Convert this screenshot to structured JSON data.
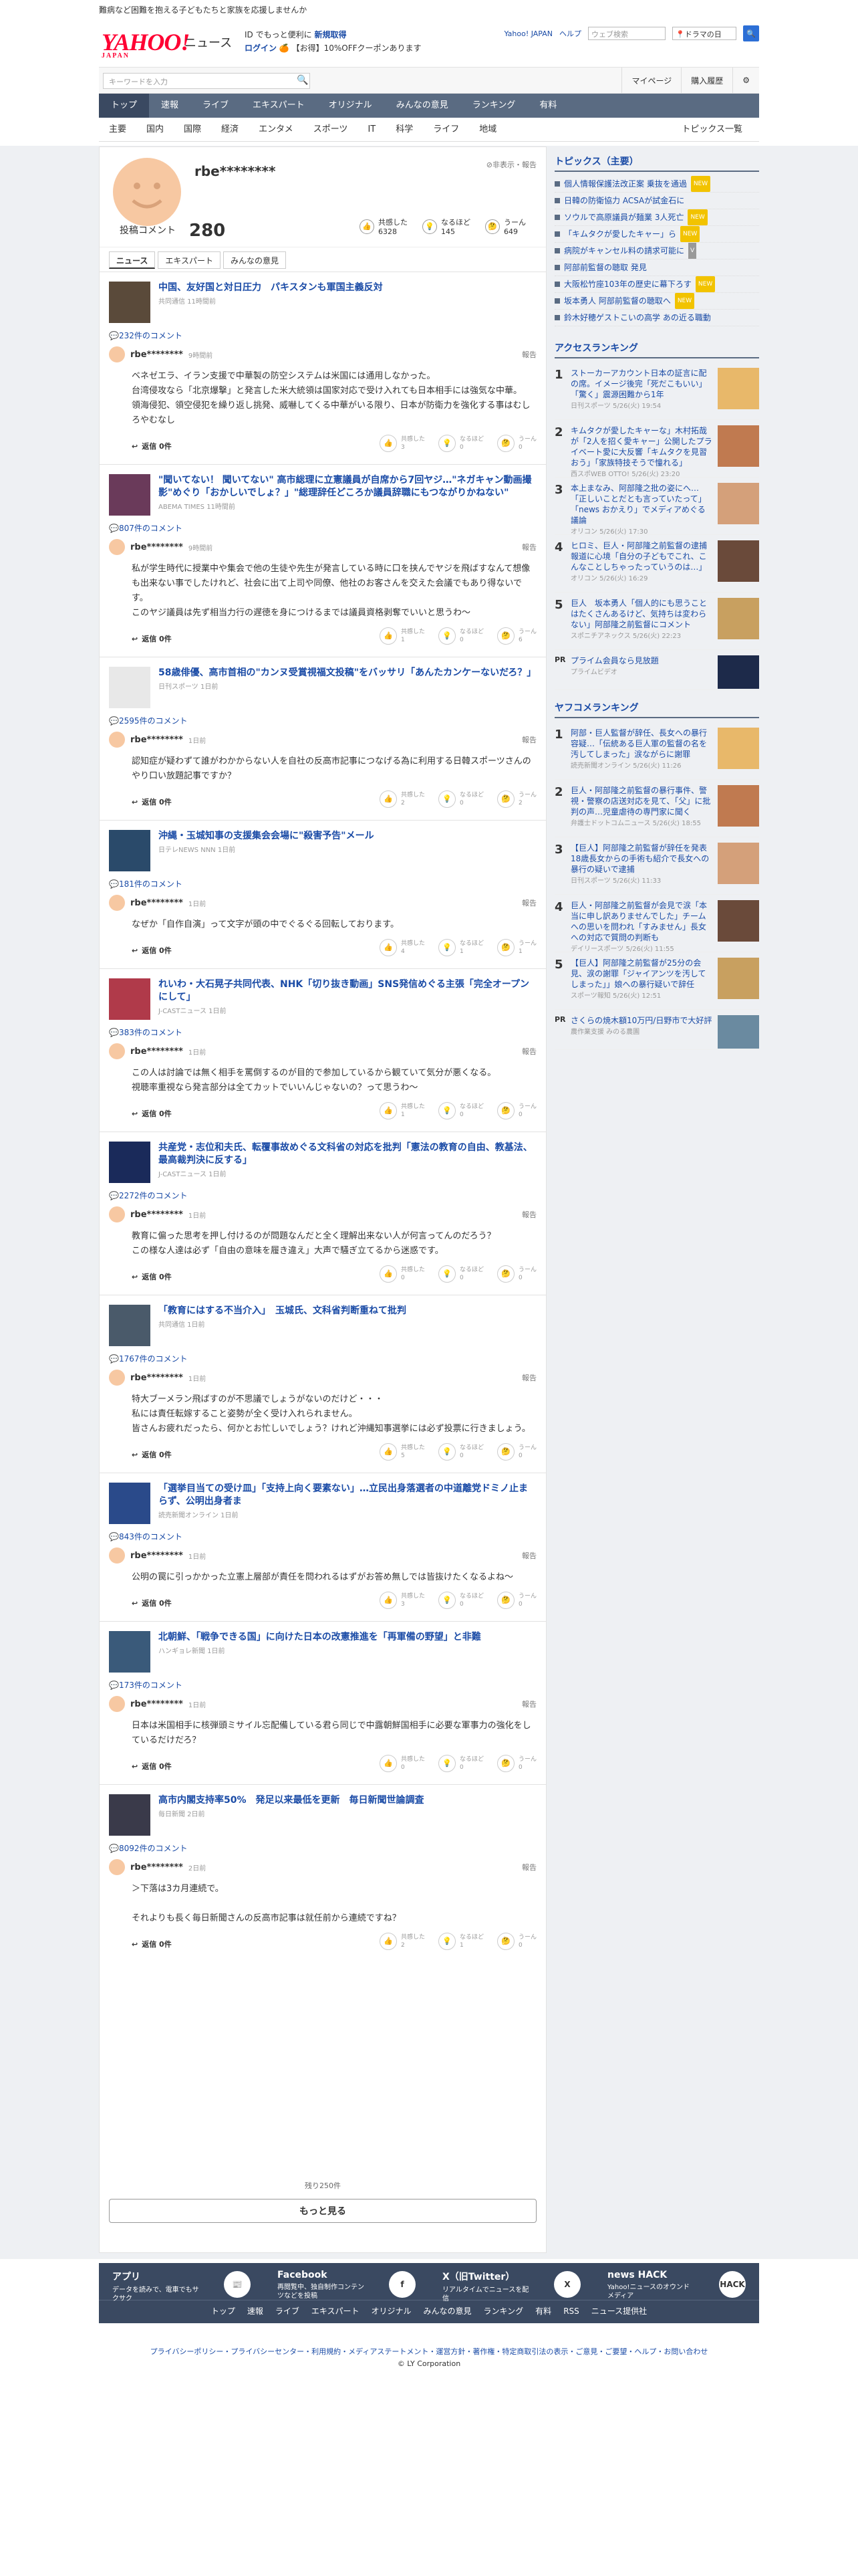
{
  "promo": "難病など困難を抱える子どもたちと家族を応援しませんか",
  "header": {
    "logo": "YAHOO!",
    "logo_sub": "JAPAN",
    "service": "ニュース",
    "reg1": "ID でもっと便利に",
    "reg1_link": "新規取得",
    "reg2_login": "ログイン",
    "reg2": "【お得】10%OFFクーポンあります",
    "yahoo_japan": "Yahoo! JAPAN",
    "help": "ヘルプ",
    "web_search_ph": "ウェブ検索",
    "keyword": "ドラマの日",
    "search_ph": "キーワードを入力",
    "mypage": "マイページ",
    "purchase": "購入履歴"
  },
  "nav": [
    "トップ",
    "速報",
    "ライブ",
    "エキスパート",
    "オリジナル",
    "みんなの意見",
    "ランキング",
    "有料"
  ],
  "subnav": [
    "主要",
    "国内",
    "国際",
    "経済",
    "エンタメ",
    "スポーツ",
    "IT",
    "科学",
    "ライフ",
    "地域"
  ],
  "subnav_right": "トピックス一覧",
  "profile": {
    "name": "rbe********",
    "hide": "非表示・報告",
    "count_label": "投稿コメント",
    "count": "280",
    "stats": [
      {
        "l": "共感した",
        "v": "6328"
      },
      {
        "l": "なるほど",
        "v": "145"
      },
      {
        "l": "うーん",
        "v": "649"
      }
    ]
  },
  "tabs": [
    "ニュース",
    "エキスパート",
    "みんなの意見"
  ],
  "entries": [
    {
      "title": "中国、友好国と対日圧力　パキスタンも軍国主義反対",
      "src": "共同通信 11時間前",
      "cnt": "232件のコメント",
      "user": "rbe********",
      "time": "9時間前",
      "text": "ベネゼエラ、イラン支援で中華製の防空システムは米国には通用しなかった。\n台湾侵攻なら「北京爆撃」と発言した米大統領は国家対応で受け入れても日本相手には強気な中華。\n領海侵犯、領空侵犯を繰り返し挑発、威嚇してくる中華がいる限り、日本が防衛力を強化する事はむしろやむなし",
      "rep": "報告",
      "reply": "返信 0件",
      "r": [
        "3",
        "0",
        "0"
      ],
      "th": "#5a4a3a"
    },
    {
      "title": "\"聞いてない！ 聞いてない\" 高市総理に立憲議員が自席から7回ヤジ…\"ネガキャン動画撮影\"めぐり「おかしいでしょ？」\"総理辞任どころか議員辞職にもつながりかねない\"",
      "src": "ABEMA TIMES 11時間前",
      "cnt": "807件のコメント",
      "user": "rbe********",
      "time": "9時間前",
      "text": "私が学生時代に授業中や集会で他の生徒や先生が発言している時に口を挟んでヤジを飛ばすなんて想像も出来ない事でしたけれど、社会に出て上司や同僚、他社のお客さんを交えた会議でもあり得ないです。\nこのヤジ議員は先ず相当力行の遅徳を身につけるまでは議員資格剥奪でいいと思うわ〜",
      "rep": "報告",
      "reply": "返信 0件",
      "r": [
        "1",
        "0",
        "6"
      ],
      "th": "#6a3a5a"
    },
    {
      "title": "58歳俳優、高市首相の\"カンヌ受賞視福文投稿\"をバッサリ「あんたカンケーないだろ？」",
      "src": "日刊スポーツ 1日前",
      "cnt": "2595件のコメント",
      "user": "rbe********",
      "time": "1日前",
      "text": "認知症が疑わずて誰がわかからない人を自社の反高市記事につなげる為に利用する日韓スポーツさんのやり口い放題記事ですか？",
      "rep": "報告",
      "reply": "返信 0件",
      "r": [
        "2",
        "0",
        "2"
      ],
      "th": "#e8e8e8"
    },
    {
      "title": "沖縄・玉城知事の支援集会会場に\"殺害予告\"メール",
      "src": "日テレNEWS NNN 1日前",
      "cnt": "181件のコメント",
      "user": "rbe********",
      "time": "1日前",
      "text": "なぜか「自作自演」って文字が頭の中でぐるぐる回転しております。",
      "rep": "報告",
      "reply": "返信 0件",
      "r": [
        "4",
        "1",
        "1"
      ],
      "th": "#2a4a6a"
    },
    {
      "title": "れいわ・大石晃子共同代表、NHK「切り抜き動画」SNS発信めぐる主張「完全オープンにして」",
      "src": "J-CASTニュース 1日前",
      "cnt": "383件のコメント",
      "user": "rbe********",
      "time": "1日前",
      "text": "この人は討論では無く相手を罵倒するのが目的で参加しているから観ていて気分が悪くなる。\n視聴率重視なら発言部分は全てカットでいいんじゃないの？って思うわ〜",
      "rep": "報告",
      "reply": "返信 0件",
      "r": [
        "1",
        "0",
        "0"
      ],
      "th": "#b03a4a"
    },
    {
      "title": "共産党・志位和夫氏、転覆事故めぐる文科省の対応を批判「憲法の教育の自由、教基法、最高裁判決に反する」",
      "src": "J-CASTニュース 1日前",
      "cnt": "2272件のコメント",
      "user": "rbe********",
      "time": "1日前",
      "text": "教育に偏った思考を押し付けるのが問題なんだと全く理解出来ない人が何言ってんのだろう？\nこの様な人達は必ず「自由の意味を履き違え」大声で騒ぎ立てるから迷惑です。",
      "rep": "報告",
      "reply": "返信 0件",
      "r": [
        "0",
        "0",
        "0"
      ],
      "th": "#1a2a5a"
    },
    {
      "title": "「教育にはする不当介入」　玉城氏、文科省判断重ねて批判",
      "src": "共同通信 1日前",
      "cnt": "1767件のコメント",
      "user": "rbe********",
      "time": "1日前",
      "text": "特大ブーメラン飛ばすのが不思議でしょうがないのだけど・・・\n私には責任転嫁すること姿勢が全く受け入れられません。\n皆さんお疲れだったら、何かとお忙しいでしょう？けれど沖縄知事選挙には必ず投票に行きましょう。",
      "rep": "報告",
      "reply": "返信 0件",
      "r": [
        "5",
        "0",
        "0"
      ],
      "th": "#4a5a6a"
    },
    {
      "title": "「選挙目当ての受け皿」「支持上向く要素ない」…立民出身落選者の中道離党ドミノ止まらず、公明出身者ま",
      "src": "読売新聞オンライン 1日前",
      "cnt": "843件のコメント",
      "user": "rbe********",
      "time": "1日前",
      "text": "公明の罠に引っかかった立憲上層部が責任を問われるはずがお答め無しでは皆抜けたくなるよね〜",
      "rep": "報告",
      "reply": "返信 0件",
      "r": [
        "3",
        "0",
        "0"
      ],
      "th": "#2a4a8a"
    },
    {
      "title": "北朝鮮、「戦争できる国」に向けた日本の改憲推進を「再軍備の野望」と非難",
      "src": "ハンギョレ新聞 1日前",
      "cnt": "173件のコメント",
      "user": "rbe********",
      "time": "1日前",
      "text": "日本は米国相手に核弾頭ミサイル忘配備している君ら同じで中露朝鮮国相手に必要な軍事力の強化をしているだけだろ？",
      "rep": "報告",
      "reply": "返信 0件",
      "r": [
        "0",
        "0",
        "0"
      ],
      "th": "#3a5a7a"
    },
    {
      "title": "高市内閣支持率50%　発足以来最低を更新　毎日新聞世論調査",
      "src": "毎日新聞 2日前",
      "cnt": "8092件のコメント",
      "user": "rbe********",
      "time": "2日前",
      "text": "＞下落は3カ月連続で。\n\nそれよりも長く毎日新聞さんの反高市記事は就任前から連続ですね？",
      "rep": "報告",
      "reply": "返信 0件",
      "r": [
        "2",
        "1",
        "0"
      ],
      "th": "#3a3a4a"
    }
  ],
  "remain": "残り250件",
  "more": "もっと見る",
  "side": {
    "topics_head": "トピックス（主要）",
    "topics": [
      {
        "t": "個人情報保護法改正案 乗抜を通過",
        "g": "NEW"
      },
      {
        "t": "日韓の防衛協力 ACSAが試金石に",
        "g": ""
      },
      {
        "t": "ソウルで高原議員が麺業 3人死亡",
        "g": "NEW"
      },
      {
        "t": "「キムタクが愛したキャー」ら",
        "g": "NEW"
      },
      {
        "t": "病院がキャンセル料の請求可能に",
        "g": "V"
      },
      {
        "t": "阿部前監督の聴取 発見",
        "g": ""
      },
      {
        "t": "大阪松竹座103年の歴史に幕下ろす",
        "g": "NEW"
      },
      {
        "t": "坂本勇人 阿部前監督の聴取へ",
        "g": "NEW"
      },
      {
        "t": "鈴木好穂ゲストこいの高学 あの近る職動",
        "g": ""
      }
    ],
    "access_head": "アクセスランキング",
    "access": [
      {
        "t": "ストーカーアカウント日本の証言に配の席。イメージ後完「死だこもいい」「驚く」震源困難から1年",
        "s": "日刊スポーツ 5/26(火) 19:54"
      },
      {
        "t": "キムタクが愛したキャーな」木村拓哉が「2人を招く愛キャー」公開したプライベート愛に大反響「キムタクを見習おう」「家族特技そうで憧れる」",
        "s": "西スポWEB OTTO! 5/26(火) 23:20"
      },
      {
        "t": "本上まなみ、阿部隆之批の姿にへ…「正しいことだとも言っていたって」「news おかえり」でメディアめぐる議論",
        "s": "オリコン 5/26(火) 17:30"
      },
      {
        "t": "ヒロミ、巨人・阿部隆之前監督の逮捕報道に心境「自分の子どもでこれ、こんなことしちゃったっていうのは…」",
        "s": "オリコン 5/26(火) 16:29"
      },
      {
        "t": "巨人　坂本勇人「個人的にも思うことはたくさんあるけど、気持ちは変わらない」阿部隆之前監督にコメント",
        "s": "スポニチアネックス 5/26(火) 22:23"
      }
    ],
    "pr1": "プライム会員なら見放題",
    "pr1_src": "プライムビデオ",
    "yafoo_head": "ヤフコメランキング",
    "yafoo": [
      {
        "t": "阿部・巨人監督が辞任、長女への暴行容疑…「伝統ある巨人軍の監督の名を汚してしまった」涙ながらに謝罪",
        "s": "読売新聞オンライン 5/26(火) 11:26"
      },
      {
        "t": "巨人・阿部隆之前監督の暴行事件、警視・警察の店送対応を見て、「父」に批判の声…児童虐待の専門家に聞く",
        "s": "弁護士ドットコムニュース 5/26(火) 18:55"
      },
      {
        "t": "【巨人】阿部隆之前監督が辞任を発表　18歳長女からの手術も紹介で長女への暴行の疑いで逮捕",
        "s": "日刊スポーツ 5/26(火) 11:33"
      },
      {
        "t": "巨人・阿部隆之前監督が会見で涙「本当に申し訳ありませんでした」チームへの思いを問われ「すみません」長女への対応で質問の判断も",
        "s": "デイリースポーツ 5/26(火) 11:55"
      },
      {
        "t": "【巨人】阿部隆之前監督が25分の会見、涙の謝罪「ジャイアンツを汚してしまった」」娘への暴行疑いで辞任",
        "s": "スポーツ報知 5/26(火) 12:51"
      }
    ],
    "pr2": "さくらの焼木額10万円/日野市で大好評",
    "pr2_src": "農作業支援 みのる農園"
  },
  "footer": {
    "cols": [
      {
        "t": "アプリ",
        "d": "データを読みで、電車でもサクサク",
        "i": "📰"
      },
      {
        "t": "Facebook",
        "d": "再閲覧中、独自制作コンテンツなどを投稿",
        "i": "f"
      },
      {
        "t": "X（旧Twitter）",
        "d": "リアルタイムでニュースを配信",
        "i": "X"
      },
      {
        "t": "news HACK",
        "d": "Yahoo!ニュースのオウンドメディア",
        "i": "HACK"
      }
    ],
    "links": [
      "トップ",
      "速報",
      "ライブ",
      "エキスパート",
      "オリジナル",
      "みんなの意見",
      "ランキング",
      "有料",
      "RSS",
      "ニュース提供社"
    ]
  },
  "bottom": {
    "links": "プライバシーポリシー・プライバシーセンター・利用規約・メディアステートメント・運営方針・著作権・特定商取引法の表示・ご意見・ご要望・ヘルプ・お問い合わせ",
    "copy": "© LY Corporation"
  }
}
